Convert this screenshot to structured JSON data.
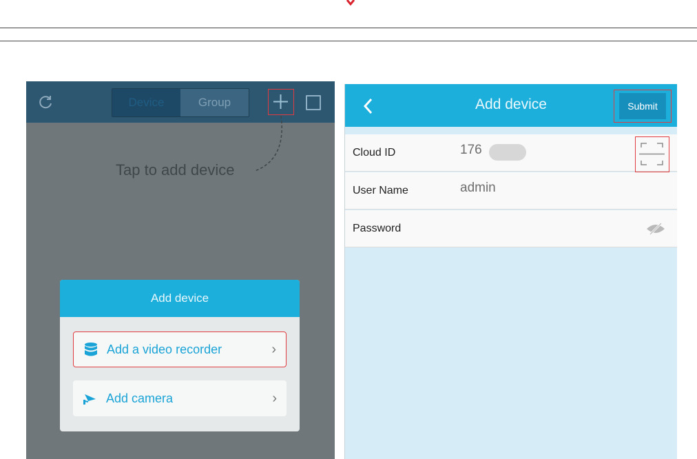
{
  "left_screen": {
    "tabs": [
      {
        "label": "Device",
        "active": true
      },
      {
        "label": "Group",
        "active": false
      }
    ],
    "hint": "Tap to add device",
    "dialog": {
      "title": "Add device",
      "options": [
        {
          "label": "Add a video recorder",
          "icon": "database-icon"
        },
        {
          "label": "Add camera",
          "icon": "camera-icon"
        }
      ]
    }
  },
  "right_screen": {
    "title": "Add device",
    "submit_label": "Submit",
    "fields": {
      "cloud_id": {
        "label": "Cloud ID",
        "value": "176"
      },
      "user_name": {
        "label": "User Name",
        "value": "admin"
      },
      "password": {
        "label": "Password",
        "value": ""
      }
    }
  },
  "colors": {
    "accent": "#1cafdc",
    "highlight_box": "#e03b3f",
    "dark_bar": "#2d5670"
  }
}
